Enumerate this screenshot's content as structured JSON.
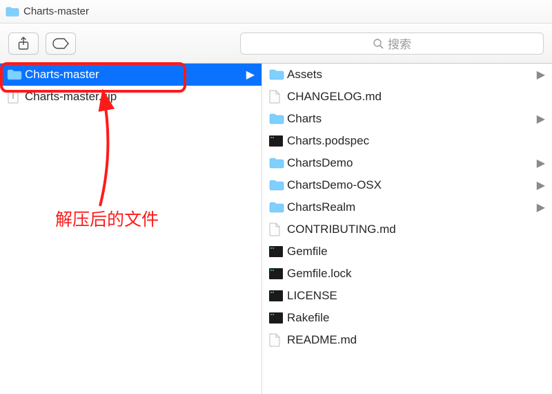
{
  "window": {
    "title": "Charts-master"
  },
  "toolbar": {
    "search_placeholder": "搜索"
  },
  "col1": {
    "items": [
      {
        "name": "Charts-master",
        "type": "folder",
        "selected": true,
        "has_children": true
      },
      {
        "name": "Charts-master.zip",
        "type": "zip",
        "selected": false,
        "has_children": false
      }
    ]
  },
  "col2": {
    "items": [
      {
        "name": "Assets",
        "type": "folder",
        "has_children": true
      },
      {
        "name": "CHANGELOG.md",
        "type": "file",
        "has_children": false
      },
      {
        "name": "Charts",
        "type": "folder",
        "has_children": true
      },
      {
        "name": "Charts.podspec",
        "type": "exec",
        "has_children": false
      },
      {
        "name": "ChartsDemo",
        "type": "folder",
        "has_children": true
      },
      {
        "name": "ChartsDemo-OSX",
        "type": "folder",
        "has_children": true
      },
      {
        "name": "ChartsRealm",
        "type": "folder",
        "has_children": true
      },
      {
        "name": "CONTRIBUTING.md",
        "type": "file",
        "has_children": false
      },
      {
        "name": "Gemfile",
        "type": "exec",
        "has_children": false
      },
      {
        "name": "Gemfile.lock",
        "type": "exec",
        "has_children": false
      },
      {
        "name": "LICENSE",
        "type": "exec",
        "has_children": false
      },
      {
        "name": "Rakefile",
        "type": "exec",
        "has_children": false
      },
      {
        "name": "README.md",
        "type": "file",
        "has_children": false
      }
    ]
  },
  "annotation": {
    "text": "解压后的文件",
    "box_color": "#ff1a1a"
  }
}
